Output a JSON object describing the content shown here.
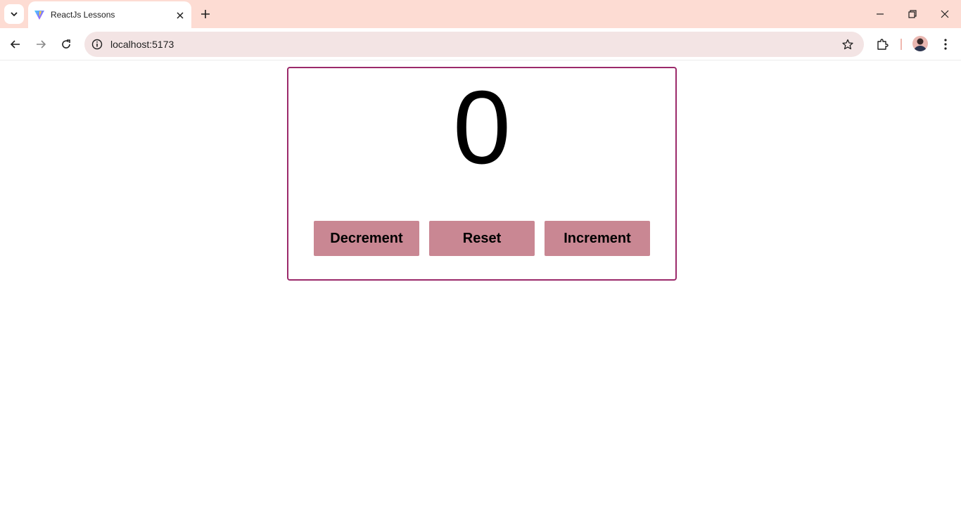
{
  "browser": {
    "tab": {
      "title": "ReactJs Lessons",
      "favicon": "vite-logo-icon"
    },
    "url": "localhost:5173",
    "colors": {
      "tabstrip": "#fddcd3",
      "omnibox": "#f3e4e4"
    }
  },
  "counter": {
    "value": "0",
    "buttons": {
      "decrement_label": "Decrement",
      "reset_label": "Reset",
      "increment_label": "Increment"
    },
    "colors": {
      "border": "#9b2a6a",
      "button": "#c98793"
    }
  }
}
